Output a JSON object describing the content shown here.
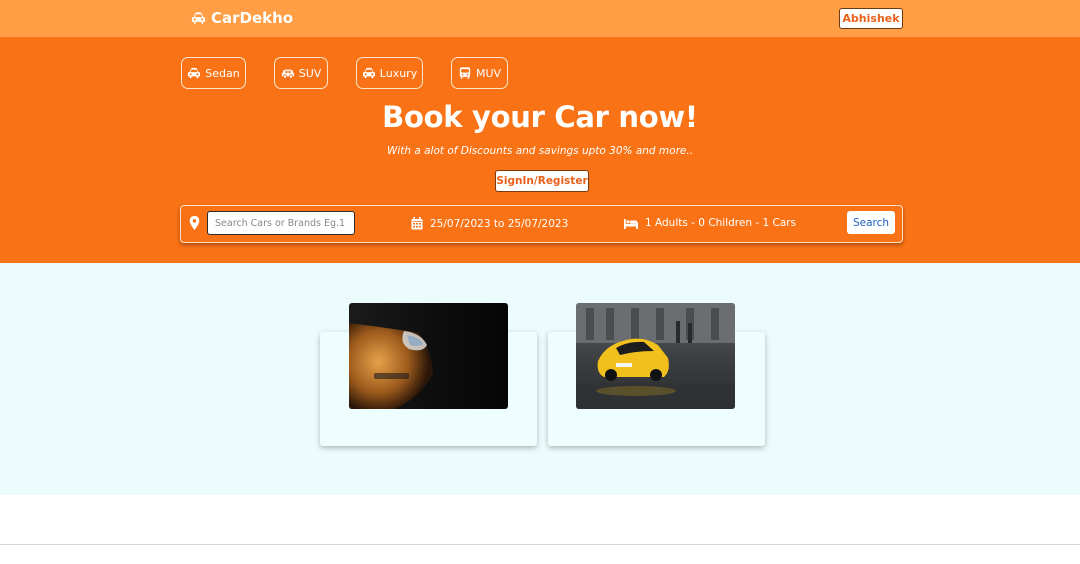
{
  "header": {
    "brand": "CarDekho",
    "user_label": "Abhishek"
  },
  "categories": [
    {
      "label": "Sedan",
      "icon": "car-icon"
    },
    {
      "label": "SUV",
      "icon": "car-side-icon"
    },
    {
      "label": "Luxury",
      "icon": "car-icon"
    },
    {
      "label": "MUV",
      "icon": "bus-icon"
    }
  ],
  "hero": {
    "title": "Book your Car now!",
    "subtitle": "With a alot of Discounts and savings upto 30% and more..",
    "signin_label": "SignIn/Register"
  },
  "search": {
    "placeholder": "Search Cars or Brands Eg.1",
    "date_range": "25/07/2023 to 25/07/2023",
    "guests": "1 Adults - 0 Children - 1 Cars",
    "button_label": "Search"
  },
  "cards": [
    {
      "image": "orange-car-headlight-photo"
    },
    {
      "image": "yellow-sports-car-street-photo"
    }
  ],
  "colors": {
    "topbar": "#ff9e44",
    "hero": "#f97316",
    "content_bg": "#ecfcfc",
    "search_button_text": "#1f5fbf"
  }
}
